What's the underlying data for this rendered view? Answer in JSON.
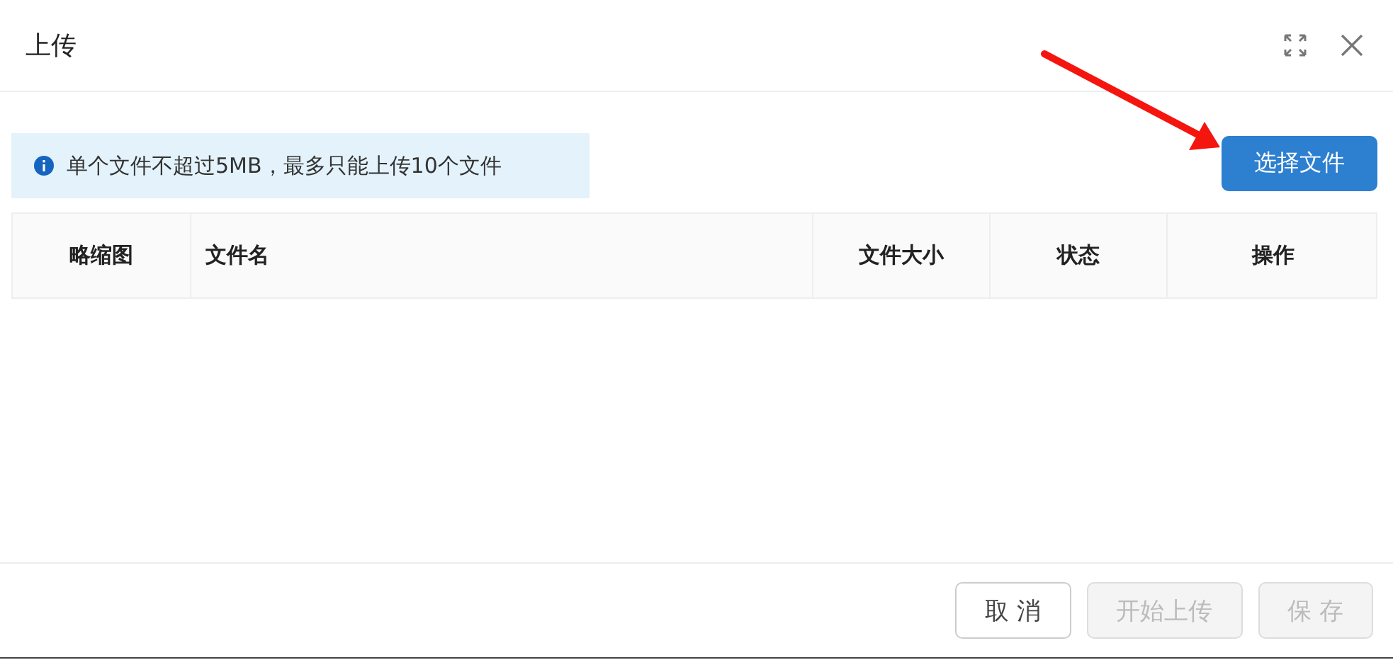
{
  "dialog": {
    "title": "上传"
  },
  "notice": {
    "text": "单个文件不超过5MB，最多只能上传10个文件"
  },
  "select_button": {
    "label": "选择文件"
  },
  "table": {
    "columns": [
      "略缩图",
      "文件名",
      "文件大小",
      "状态",
      "操作"
    ]
  },
  "footer_buttons": [
    {
      "label": "取 消",
      "disabled": false
    },
    {
      "label": "开始上传",
      "disabled": true
    },
    {
      "label": "保 存",
      "disabled": true
    }
  ]
}
